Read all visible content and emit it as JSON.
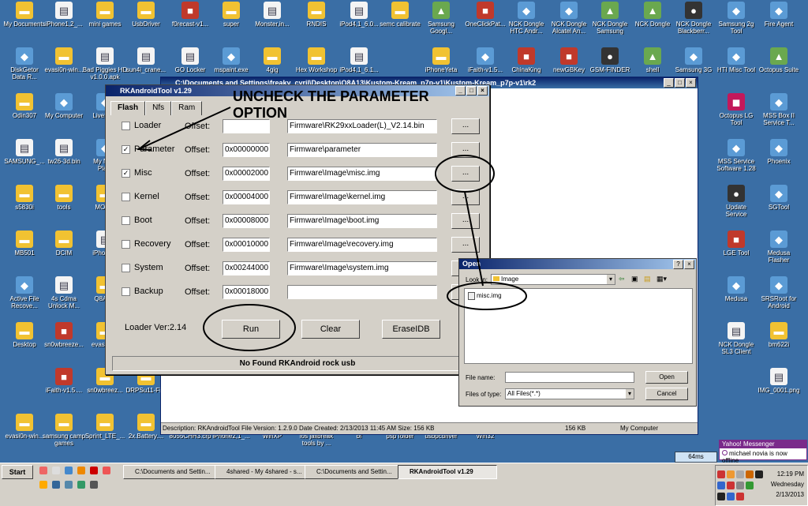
{
  "desktop_icons": [
    {
      "label": "My Documents",
      "kind": "folder"
    },
    {
      "label": "iPhone1,2_...",
      "kind": "file"
    },
    {
      "label": "mini games",
      "kind": "folder"
    },
    {
      "label": "UsbDriver",
      "kind": "folder"
    },
    {
      "label": "f0recast-v1...",
      "kind": "red"
    },
    {
      "label": "super",
      "kind": "folder"
    },
    {
      "label": "Monster,in...",
      "kind": "file"
    },
    {
      "label": "RNDIS",
      "kind": "folder"
    },
    {
      "label": "iPod4,1_6.0...",
      "kind": "file"
    },
    {
      "label": "semc calibrate",
      "kind": "folder"
    },
    {
      "label": "Samsung\nGoogl...",
      "kind": "green"
    },
    {
      "label": "OneClickPat...",
      "kind": "red"
    },
    {
      "label": "NCK Dongle\nHTC Andr...",
      "kind": "app"
    },
    {
      "label": "NCK Dongle\nAlcatel An...",
      "kind": "app"
    },
    {
      "label": "NCK Dongle\nSamsung",
      "kind": "green"
    },
    {
      "label": "NCK Dongle",
      "kind": "green"
    },
    {
      "label": "NCK Dongle\nBlackberr...",
      "kind": "dark"
    },
    {
      "label": "Samsung 2g\nTool",
      "kind": "app"
    },
    {
      "label": "Fire Agent",
      "kind": "app"
    },
    {
      "label": "DiskGetor\nData R...",
      "kind": "app"
    },
    {
      "label": "evasi0n-win...",
      "kind": "folder"
    },
    {
      "label": "Bad Piggies HD\nv1.0.0.apk",
      "kind": "file"
    },
    {
      "label": "sun4i_crane...",
      "kind": "file"
    },
    {
      "label": "GO Locker",
      "kind": "file"
    },
    {
      "label": "mspaint.exe",
      "kind": "app"
    },
    {
      "label": "4gig",
      "kind": "folder"
    },
    {
      "label": "Hex Workshop",
      "kind": "folder"
    },
    {
      "label": "iPod4,1_6.1...",
      "kind": "file"
    },
    {
      "label": "iPhoneYeta",
      "kind": "folder"
    },
    {
      "label": "iFaith-v1.5...",
      "kind": "app"
    },
    {
      "label": "ChinaKing",
      "kind": "red"
    },
    {
      "label": "newGBKey",
      "kind": "red"
    },
    {
      "label": "GSM-FINDER",
      "kind": "dark"
    },
    {
      "label": "shell",
      "kind": "green"
    },
    {
      "label": "Samsung 3G",
      "kind": "app"
    },
    {
      "label": "HTI Misc Tool",
      "kind": "app"
    },
    {
      "label": "Octopus Suite",
      "kind": "green"
    },
    {
      "label": "Odin307",
      "kind": "folder"
    },
    {
      "label": "My Computer",
      "kind": "app"
    },
    {
      "label": "LiveSu...",
      "kind": "app"
    },
    {
      "label": "Octopus LG\nTool",
      "kind": "pink"
    },
    {
      "label": "MSS Box II\nService T...",
      "kind": "app"
    },
    {
      "label": "SAMSUNG_...",
      "kind": "file"
    },
    {
      "label": "tw26-3d.bin",
      "kind": "file"
    },
    {
      "label": "My Ne...\nPla...",
      "kind": "app"
    },
    {
      "label": "MSS Service\nSoftware 1.28",
      "kind": "app"
    },
    {
      "label": "Phoenix",
      "kind": "app"
    },
    {
      "label": "s5830i",
      "kind": "folder"
    },
    {
      "label": "tools",
      "kind": "folder"
    },
    {
      "label": "MON...",
      "kind": "folder"
    },
    {
      "label": "Update\nService",
      "kind": "dark"
    },
    {
      "label": "SGTool",
      "kind": "app"
    },
    {
      "label": "MB501",
      "kind": "folder"
    },
    {
      "label": "DCIM",
      "kind": "folder"
    },
    {
      "label": "iPhone...",
      "kind": "file"
    },
    {
      "label": "LGE Tool",
      "kind": "red"
    },
    {
      "label": "Medusa\nFlasher",
      "kind": "app"
    },
    {
      "label": "Active File\nRecove...",
      "kind": "app"
    },
    {
      "label": "4s Cdma\nUnlock M...",
      "kind": "file"
    },
    {
      "label": "Q8A1...",
      "kind": "folder"
    },
    {
      "label": "Medusa",
      "kind": "app"
    },
    {
      "label": "SRSRoot for\nAndroid",
      "kind": "app"
    },
    {
      "label": "Desktop",
      "kind": "folder"
    },
    {
      "label": "sn0wbreeze...",
      "kind": "red"
    },
    {
      "label": "evasi0n...",
      "kind": "folder"
    },
    {
      "label": "NCK Dongle\nSL3 Client",
      "kind": "file"
    },
    {
      "label": "bm622i",
      "kind": "folder"
    },
    {
      "label": "iFaith-v1.5....",
      "kind": "red"
    },
    {
      "label": "sn0wbreez...",
      "kind": "folder"
    },
    {
      "label": "DRPSu11-Fi...",
      "kind": "folder"
    },
    {
      "label": "IMG_0001.png",
      "kind": "file"
    },
    {
      "label": "evasi0n-win...",
      "kind": "folder"
    },
    {
      "label": "samsung camp\ngames",
      "kind": "folder"
    },
    {
      "label": "Sprint_LTE_...",
      "kind": "folder"
    },
    {
      "label": "2x.Battery....",
      "kind": "folder"
    },
    {
      "label": "8055CHH3.crp",
      "kind": "file"
    },
    {
      "label": "iPhone2,1_...",
      "kind": "file"
    },
    {
      "label": "WinXP",
      "kind": "folder"
    },
    {
      "label": "ios jailbreak\ntools by ...",
      "kind": "folder"
    },
    {
      "label": "bf",
      "kind": "folder"
    },
    {
      "label": "psp folder",
      "kind": "folder"
    },
    {
      "label": "usbpcdriver",
      "kind": "folder"
    },
    {
      "label": "Win32",
      "kind": "folder"
    }
  ],
  "explorer": {
    "title": "C:\\Documents and Settings\\freaky_cyril\\Desktop\\Q8A13\\Kustom-Kream_p7p-v1\\Kustom-Kream_p7p-v1\\rk2",
    "status_desc": "Description: RKAndroidTool File Version: 1.2.9.0 Date Created: 2/13/2013 11:45 AM Size: 156 KB",
    "status_size": "156 KB",
    "status_loc": "My Computer"
  },
  "rk": {
    "title": "RKAndroidTool v1.29",
    "tabs": [
      "Flash",
      "Nfs",
      "Ram"
    ],
    "offset_label": "Offset:",
    "rows": [
      {
        "name": "Loader",
        "checked": false,
        "offset": "",
        "path": "Firmware\\RK29xxLoader(L)_V2.14.bin"
      },
      {
        "name": "Parameter",
        "checked": true,
        "offset": "0x00000000",
        "path": "Firmware\\parameter"
      },
      {
        "name": "Misc",
        "checked": true,
        "offset": "0x00002000",
        "path": "Firmware\\Image\\misc.img"
      },
      {
        "name": "Kernel",
        "checked": false,
        "offset": "0x00004000",
        "path": "Firmware\\Image\\kernel.img"
      },
      {
        "name": "Boot",
        "checked": false,
        "offset": "0x00008000",
        "path": "Firmware\\Image\\boot.img"
      },
      {
        "name": "Recovery",
        "checked": false,
        "offset": "0x00010000",
        "path": "Firmware\\Image\\recovery.img"
      },
      {
        "name": "System",
        "checked": false,
        "offset": "0x00244000",
        "path": "Firmware\\Image\\system.img"
      },
      {
        "name": "Backup",
        "checked": false,
        "offset": "0x00018000",
        "path": ""
      }
    ],
    "browse_label": "...",
    "loader_ver": "Loader Ver:2.14",
    "run": "Run",
    "clear": "Clear",
    "erase": "EraseIDB",
    "status": "No Found RKAndroid rock usb"
  },
  "annotation": "UNCHECK THE PARAMETER\nOPTION",
  "open_dialog": {
    "title": "Open",
    "look_in_label": "Look in:",
    "look_in_value": "Image",
    "file_item": "misc.img",
    "file_name_label": "File name:",
    "file_name_value": "",
    "files_type_label": "Files of type:",
    "files_type_value": "All Files(*.*)",
    "open_btn": "Open",
    "cancel_btn": "Cancel"
  },
  "taskbar": {
    "start": "Start",
    "items": [
      {
        "label": "C:\\Documents and Settin...",
        "active": false
      },
      {
        "label": "4shared - My 4shared - s...",
        "active": false
      },
      {
        "label": "C:\\Documents and Settin...",
        "active": false
      },
      {
        "label": "RKAndroidTool v1.29",
        "active": true
      }
    ],
    "time": "12:19 PM",
    "day": "Wednesday",
    "date": "2/13/2013",
    "speed": "64ms"
  },
  "yahoo": {
    "title": "Yahoo! Messenger",
    "text": "michael novia is now offline"
  },
  "colors": {
    "desktop": "#3a6ea5",
    "titlebar": "#0a246a",
    "annotation_stroke": "#000000"
  }
}
